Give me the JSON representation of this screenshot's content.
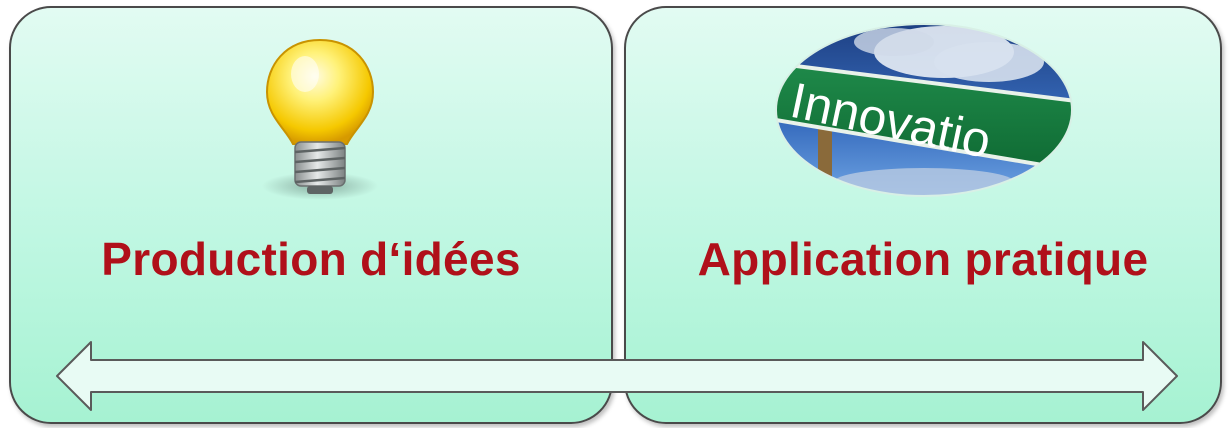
{
  "panels": [
    {
      "label": "Production d‘idées",
      "illustration": "lightbulb-icon"
    },
    {
      "label": "Application pratique",
      "illustration": "innovation-sign-image",
      "sign_text": "Innovatio"
    }
  ],
  "arrow": {
    "type": "double-headed",
    "color": "#e8fbf4"
  },
  "colors": {
    "label": "#b0101a",
    "panel_fill": "#bff7e2",
    "panel_border": "#4a4a4a"
  }
}
